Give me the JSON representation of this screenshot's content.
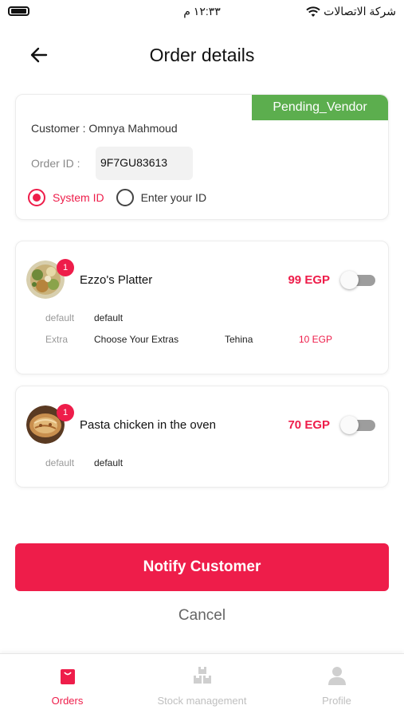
{
  "status_bar": {
    "time": "١٢:٣٣ م",
    "carrier": "شركة الاتصالات"
  },
  "header": {
    "title": "Order details"
  },
  "order": {
    "status": "Pending_Vendor",
    "customer_label": "Customer :",
    "customer_name": "Omnya  Mahmoud",
    "order_id_label": "Order ID :",
    "order_id": "9F7GU83613",
    "id_options": [
      {
        "label": "System ID",
        "selected": true
      },
      {
        "label": "Enter your ID",
        "selected": false
      }
    ]
  },
  "items": [
    {
      "name": "Ezzo's Platter",
      "price": "99 EGP",
      "quantity": "1",
      "toggle_on": false,
      "options": [
        {
          "key": "default",
          "value": "default"
        },
        {
          "key": "Extra",
          "value": "Choose Your Extras",
          "choice": "Tehina",
          "price": "10 EGP"
        }
      ]
    },
    {
      "name": "Pasta chicken in the oven",
      "price": "70 EGP",
      "quantity": "1",
      "toggle_on": false,
      "options": [
        {
          "key": "default",
          "value": "default"
        }
      ]
    }
  ],
  "actions": {
    "notify": "Notify Customer",
    "cancel": "Cancel"
  },
  "bottom_nav": [
    {
      "label": "Orders",
      "icon": "bag-icon",
      "active": true
    },
    {
      "label": "Stock management",
      "icon": "boxes-icon",
      "active": false
    },
    {
      "label": "Profile",
      "icon": "person-icon",
      "active": false
    }
  ],
  "colors": {
    "accent": "#ee1d4a",
    "status_green": "#5cae4e",
    "inactive": "#bfbfbf"
  }
}
